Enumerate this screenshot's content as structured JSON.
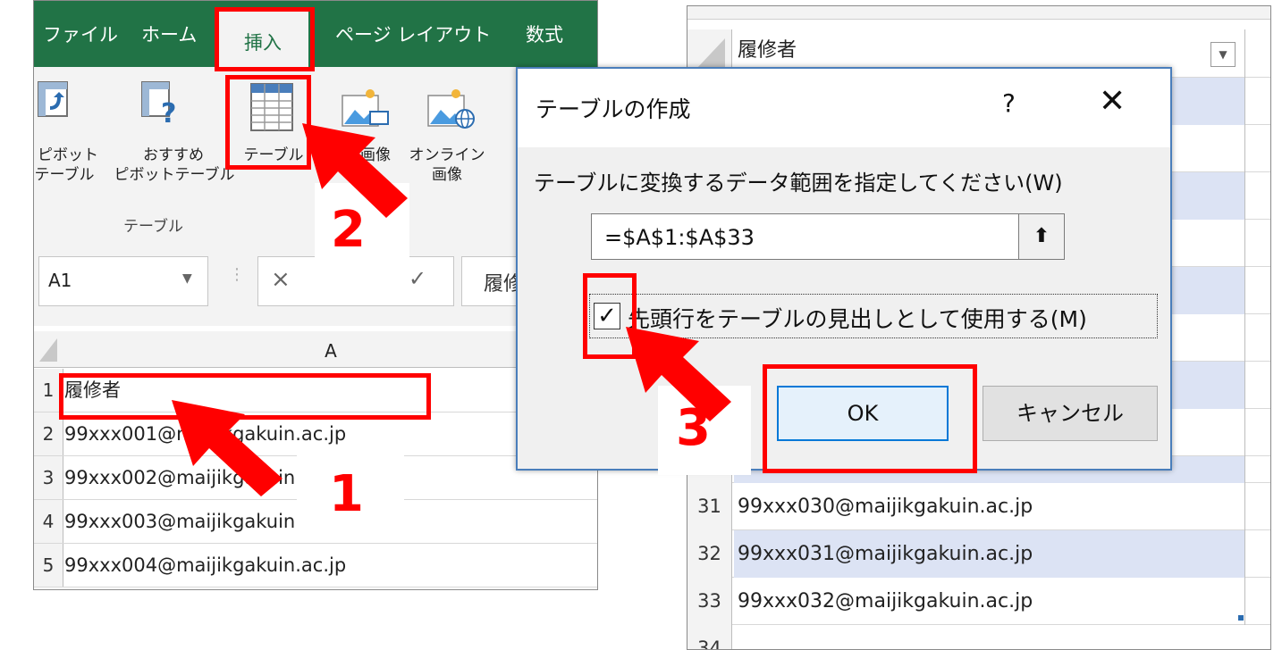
{
  "ribbon": {
    "tabs": [
      "ファイル",
      "ホーム",
      "挿入",
      "ページ レイアウト",
      "数式"
    ],
    "active_tab": "挿入",
    "buttons": {
      "pivot_line1": "ピボット",
      "pivot_line2": "テーブル",
      "rec_pivot_line1": "おすすめ",
      "rec_pivot_line2": "ピボットテーブル",
      "table": "テーブル",
      "image": "画像",
      "online_line1": "オンライン",
      "online_line2": "画像"
    },
    "group_label": "テーブル"
  },
  "formula_bar": {
    "namebox": "A1",
    "cancel_symbol": "×",
    "enter_symbol": "✓",
    "content_partial": "履修"
  },
  "sheet_left": {
    "column_header": "A",
    "rows": [
      {
        "num": "1",
        "value": "履修者"
      },
      {
        "num": "2",
        "value": "99xxx001@maijikgakuin.ac.jp"
      },
      {
        "num": "3",
        "value": "99xxx002@maijikgakuin.ac.jp"
      },
      {
        "num": "4",
        "value": "99xxx003@maijikgakuin.ac.jp"
      },
      {
        "num": "5",
        "value": "99xxx004@maijikgakuin.ac.jp"
      }
    ]
  },
  "sheet_right": {
    "header": "履修者",
    "rows": [
      {
        "num": "31",
        "value": "99xxx030@maijikgakuin.ac.jp"
      },
      {
        "num": "32",
        "value": "99xxx031@maijikgakuin.ac.jp"
      },
      {
        "num": "33",
        "value": "99xxx032@maijikgakuin.ac.jp"
      },
      {
        "num": "34",
        "value": ""
      }
    ],
    "band_color": "#dce3f4"
  },
  "dialog": {
    "title": "テーブルの作成",
    "help": "?",
    "close": "✕",
    "prompt": "テーブルに変換するデータ範囲を指定してください(W)",
    "range": "=$A$1:$A$33",
    "range_button": "⬆",
    "checkbox_label": "先頭行をテーブルの見出しとして使用する(M)",
    "checkbox_checked": "✓",
    "ok": "OK",
    "cancel": "キャンセル"
  },
  "annotations": {
    "step1": "1",
    "step2": "2",
    "step3": "3",
    "color": "#ff0000"
  },
  "colors": {
    "excel_green": "#217346",
    "dialog_border": "#4a7ebb",
    "ok_border": "#0078d7"
  }
}
